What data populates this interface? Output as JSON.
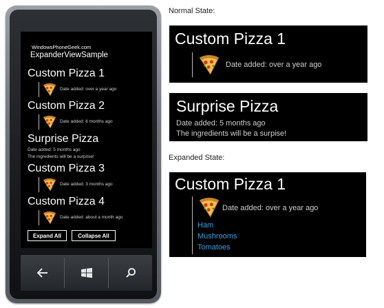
{
  "phone": {
    "site": "WindowsPhoneGeek.com",
    "app_title": "ExpanderViewSample",
    "items": [
      {
        "title": "Custom Pizza 1",
        "date": "Date added: over a year ago"
      },
      {
        "title": "Custom Pizza 2",
        "date": "Date added: 6 months ago"
      },
      {
        "title": "Surprise Pizza",
        "date": "Date added: 5 months ago",
        "description": "The ingredients will be a surprise!"
      },
      {
        "title": "Custom Pizza 3",
        "date": "Date added: 3 months ago"
      },
      {
        "title": "Custom Pizza 4",
        "date": "Date added: about a month ago"
      }
    ],
    "expand_all": "Expand All",
    "collapse_all": "Collapse All",
    "hardware": {
      "back": "back-icon",
      "start": "windows-logo-icon",
      "search": "search-icon"
    }
  },
  "normal_state": {
    "caption": "Normal State:",
    "panel1": {
      "title": "Custom Pizza 1",
      "date": "Date added: over a year ago"
    },
    "panel2": {
      "title": "Surprise Pizza",
      "date": "Date added: 5 months ago",
      "description": "The ingredients will be a surpise!"
    }
  },
  "expanded_state": {
    "caption": "Expanded State:",
    "panel": {
      "title": "Custom Pizza 1",
      "date": "Date added: over a year ago",
      "ingredients": [
        "Ham",
        "Mushrooms",
        "Tomatoes"
      ]
    }
  },
  "colors": {
    "phone_screen": "#000000",
    "ingredient_link": "#3f9fe0",
    "text_primary": "#ffffff",
    "text_secondary": "#cfcfcf"
  }
}
